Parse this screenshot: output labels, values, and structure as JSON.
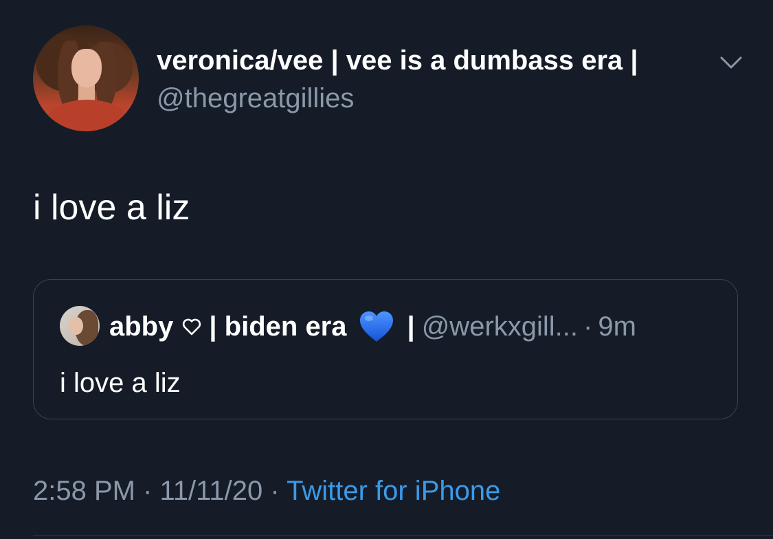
{
  "author": {
    "display_name": "veronica/vee | vee is a dumbass era |",
    "handle": "@thegreatgillies"
  },
  "tweet": {
    "text": "i love a liz"
  },
  "quoted_tweet": {
    "display_name": "abby",
    "name_suffix": "| biden era",
    "separator": "|",
    "handle": "@werkxgill...",
    "dot": "·",
    "time": "9m",
    "text": "i love a liz"
  },
  "meta": {
    "time": "2:58 PM",
    "date": "11/11/20",
    "sep1": " · ",
    "sep2": " · ",
    "source": "Twitter for iPhone"
  },
  "colors": {
    "background": "#151c28",
    "primary_text": "#ffffff",
    "secondary_text": "#8a98a9",
    "link": "#3b9ae8",
    "border": "#38444d",
    "blue_heart": "#1d6fe8"
  },
  "icons": {
    "menu": "chevron-down-icon",
    "heart_outline": "heart-outline-icon",
    "heart_blue": "blue-heart-emoji"
  }
}
